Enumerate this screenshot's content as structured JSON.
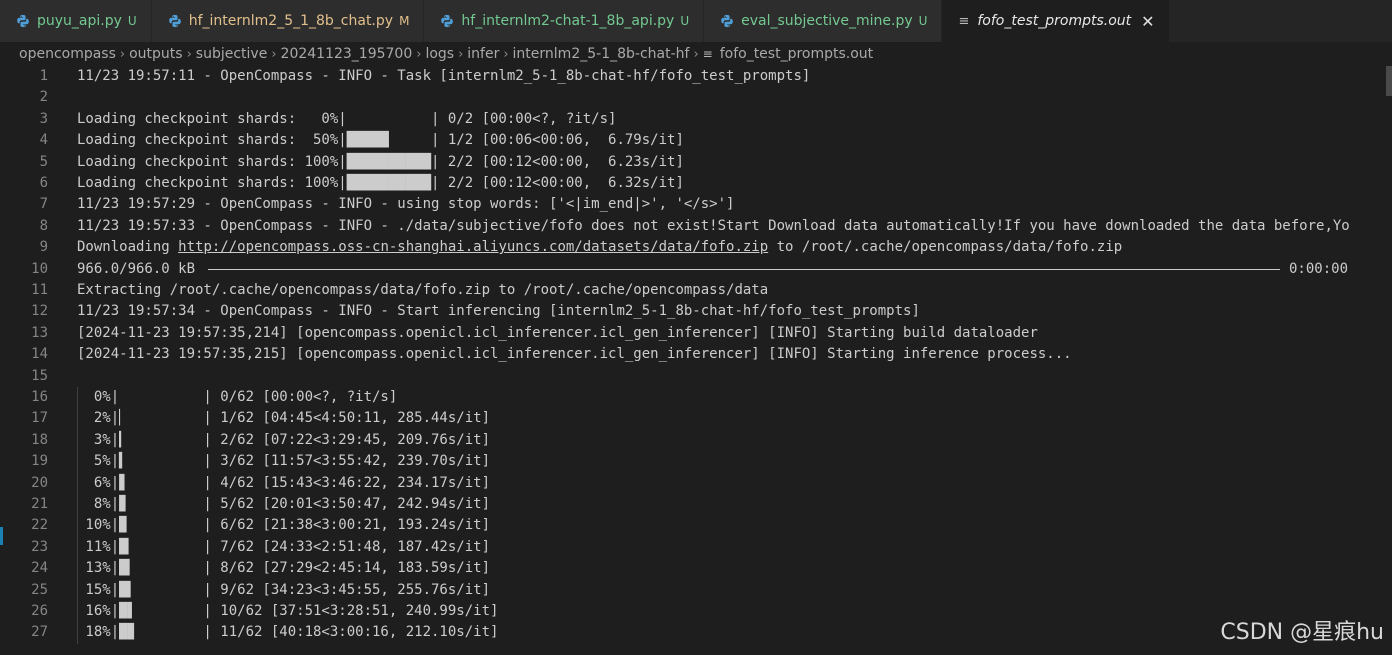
{
  "tabs": [
    {
      "name": "puyu_api.py",
      "status": "U",
      "kind": "py",
      "state": "untracked"
    },
    {
      "name": "hf_internlm2_5_1_8b_chat.py",
      "status": "M",
      "kind": "py",
      "state": "modified"
    },
    {
      "name": "hf_internlm2-chat-1_8b_api.py",
      "status": "U",
      "kind": "py",
      "state": "untracked"
    },
    {
      "name": "eval_subjective_mine.py",
      "status": "U",
      "kind": "py",
      "state": "untracked"
    },
    {
      "name": "fofo_test_prompts.out",
      "status": "",
      "kind": "out",
      "state": "active",
      "close": "✕"
    }
  ],
  "breadcrumb": [
    "opencompass",
    "outputs",
    "subjective",
    "20241123_195700",
    "logs",
    "infer",
    "internlm2_5-1_8b-chat-hf",
    "fofo_test_prompts.out"
  ],
  "lines": [
    {
      "n": "1",
      "text": "11/23 19:57:11 - OpenCompass - INFO - Task [internlm2_5-1_8b-chat-hf/fofo_test_prompts]"
    },
    {
      "n": "2",
      "text": ""
    },
    {
      "n": "3",
      "text": "Loading checkpoint shards:   0%|          | 0/2 [00:00<?, ?it/s]"
    },
    {
      "n": "4",
      "text": "Loading checkpoint shards:  50%|█████     | 1/2 [00:06<00:06,  6.79s/it]"
    },
    {
      "n": "5",
      "text": "Loading checkpoint shards: 100%|██████████| 2/2 [00:12<00:00,  6.23s/it]"
    },
    {
      "n": "6",
      "text": "Loading checkpoint shards: 100%|██████████| 2/2 [00:12<00:00,  6.32s/it]"
    },
    {
      "n": "7",
      "text": "11/23 19:57:29 - OpenCompass - INFO - using stop words: ['<|im_end|>', '</s>']"
    },
    {
      "n": "8",
      "text": "11/23 19:57:33 - OpenCompass - INFO - ./data/subjective/fofo does not exist!Start Download data automatically!If you have downloaded the data before,Yo"
    },
    {
      "n": "9",
      "pre": "Downloading ",
      "link": "http://opencompass.oss-cn-shanghai.aliyuncs.com/datasets/data/fofo.zip",
      "post": " to /root/.cache/opencompass/data/fofo.zip"
    },
    {
      "n": "10",
      "text": "966.0/966.0 kB",
      "suffix": "0:00:00"
    },
    {
      "n": "11",
      "text": "Extracting /root/.cache/opencompass/data/fofo.zip to /root/.cache/opencompass/data"
    },
    {
      "n": "12",
      "text": "11/23 19:57:34 - OpenCompass - INFO - Start inferencing [internlm2_5-1_8b-chat-hf/fofo_test_prompts]"
    },
    {
      "n": "13",
      "text": "[2024-11-23 19:57:35,214] [opencompass.openicl.icl_inferencer.icl_gen_inferencer] [INFO] Starting build dataloader"
    },
    {
      "n": "14",
      "text": "[2024-11-23 19:57:35,215] [opencompass.openicl.icl_inferencer.icl_gen_inferencer] [INFO] Starting inference process..."
    },
    {
      "n": "15",
      "text": ""
    },
    {
      "n": "16",
      "text": "  0%|          | 0/62 [00:00<?, ?it/s]"
    },
    {
      "n": "17",
      "text": "  2%|▏         | 1/62 [04:45<4:50:11, 285.44s/it]"
    },
    {
      "n": "18",
      "text": "  3%|▎         | 2/62 [07:22<3:29:45, 209.76s/it]"
    },
    {
      "n": "19",
      "text": "  5%|▍         | 3/62 [11:57<3:55:42, 239.70s/it]"
    },
    {
      "n": "20",
      "text": "  6%|▋         | 4/62 [15:43<3:46:22, 234.17s/it]"
    },
    {
      "n": "21",
      "text": "  8%|▊         | 5/62 [20:01<3:50:47, 242.94s/it]"
    },
    {
      "n": "22",
      "text": " 10%|▉         | 6/62 [21:38<3:00:21, 193.24s/it]"
    },
    {
      "n": "23",
      "text": " 11%|█▏        | 7/62 [24:33<2:51:48, 187.42s/it]"
    },
    {
      "n": "24",
      "text": " 13%|█▎        | 8/62 [27:29<2:45:14, 183.59s/it]"
    },
    {
      "n": "25",
      "text": " 15%|█▍        | 9/62 [34:23<3:45:55, 255.76s/it]"
    },
    {
      "n": "26",
      "text": " 16%|█▌        | 10/62 [37:51<3:28:51, 240.99s/it]"
    },
    {
      "n": "27",
      "text": " 18%|█▊        | 11/62 [40:18<3:00:16, 212.10s/it]"
    }
  ],
  "watermark": "CSDN @星痕hu",
  "colors": {
    "untracked": "#73c991",
    "modified": "#e2c08d",
    "background": "#1e1e1e",
    "tabbar": "#252526"
  }
}
